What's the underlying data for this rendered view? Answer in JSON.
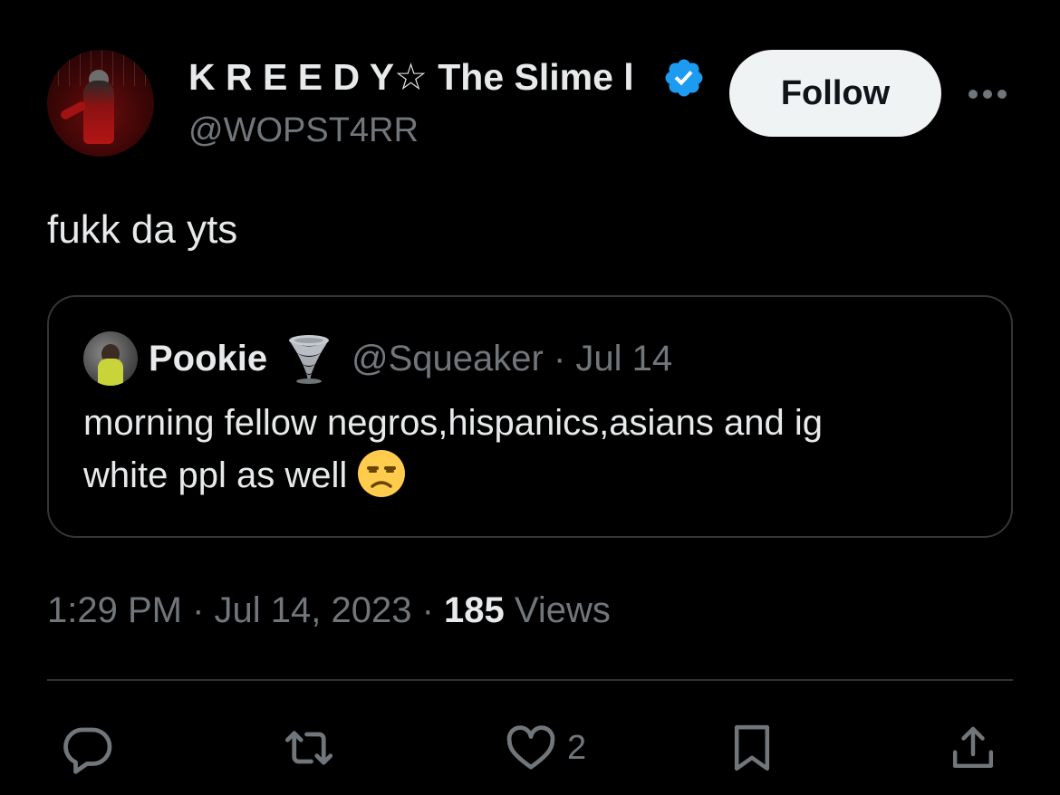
{
  "author": {
    "display_name": "K R E E D Y☆ The Slime l",
    "handle": "@WOPST4RR",
    "verified": true,
    "avatar_icon": "avatar-puppet-image"
  },
  "follow_button": {
    "label": "Follow"
  },
  "tweet": {
    "text": "fukk da yts"
  },
  "quote": {
    "display_name": "Pookie",
    "name_emoji": "tornado-icon",
    "handle_date": "@Squeaker · Jul 14",
    "text_line_1": "morning fellow negros,hispanics,asians and ig",
    "text_line_2": "white ppl as well",
    "text_emoji": "unamused-face-icon"
  },
  "meta": {
    "timestamp": "1:29 PM · Jul 14, 2023 · ",
    "views_count": "185",
    "views_label": " Views"
  },
  "actions": {
    "likes": "2"
  },
  "colors": {
    "background": "#000000",
    "text_primary": "#e7e9ea",
    "text_secondary": "#71767b",
    "verified_blue": "#1d9bf0",
    "follow_bg": "#eff3f4",
    "border": "#333639"
  }
}
